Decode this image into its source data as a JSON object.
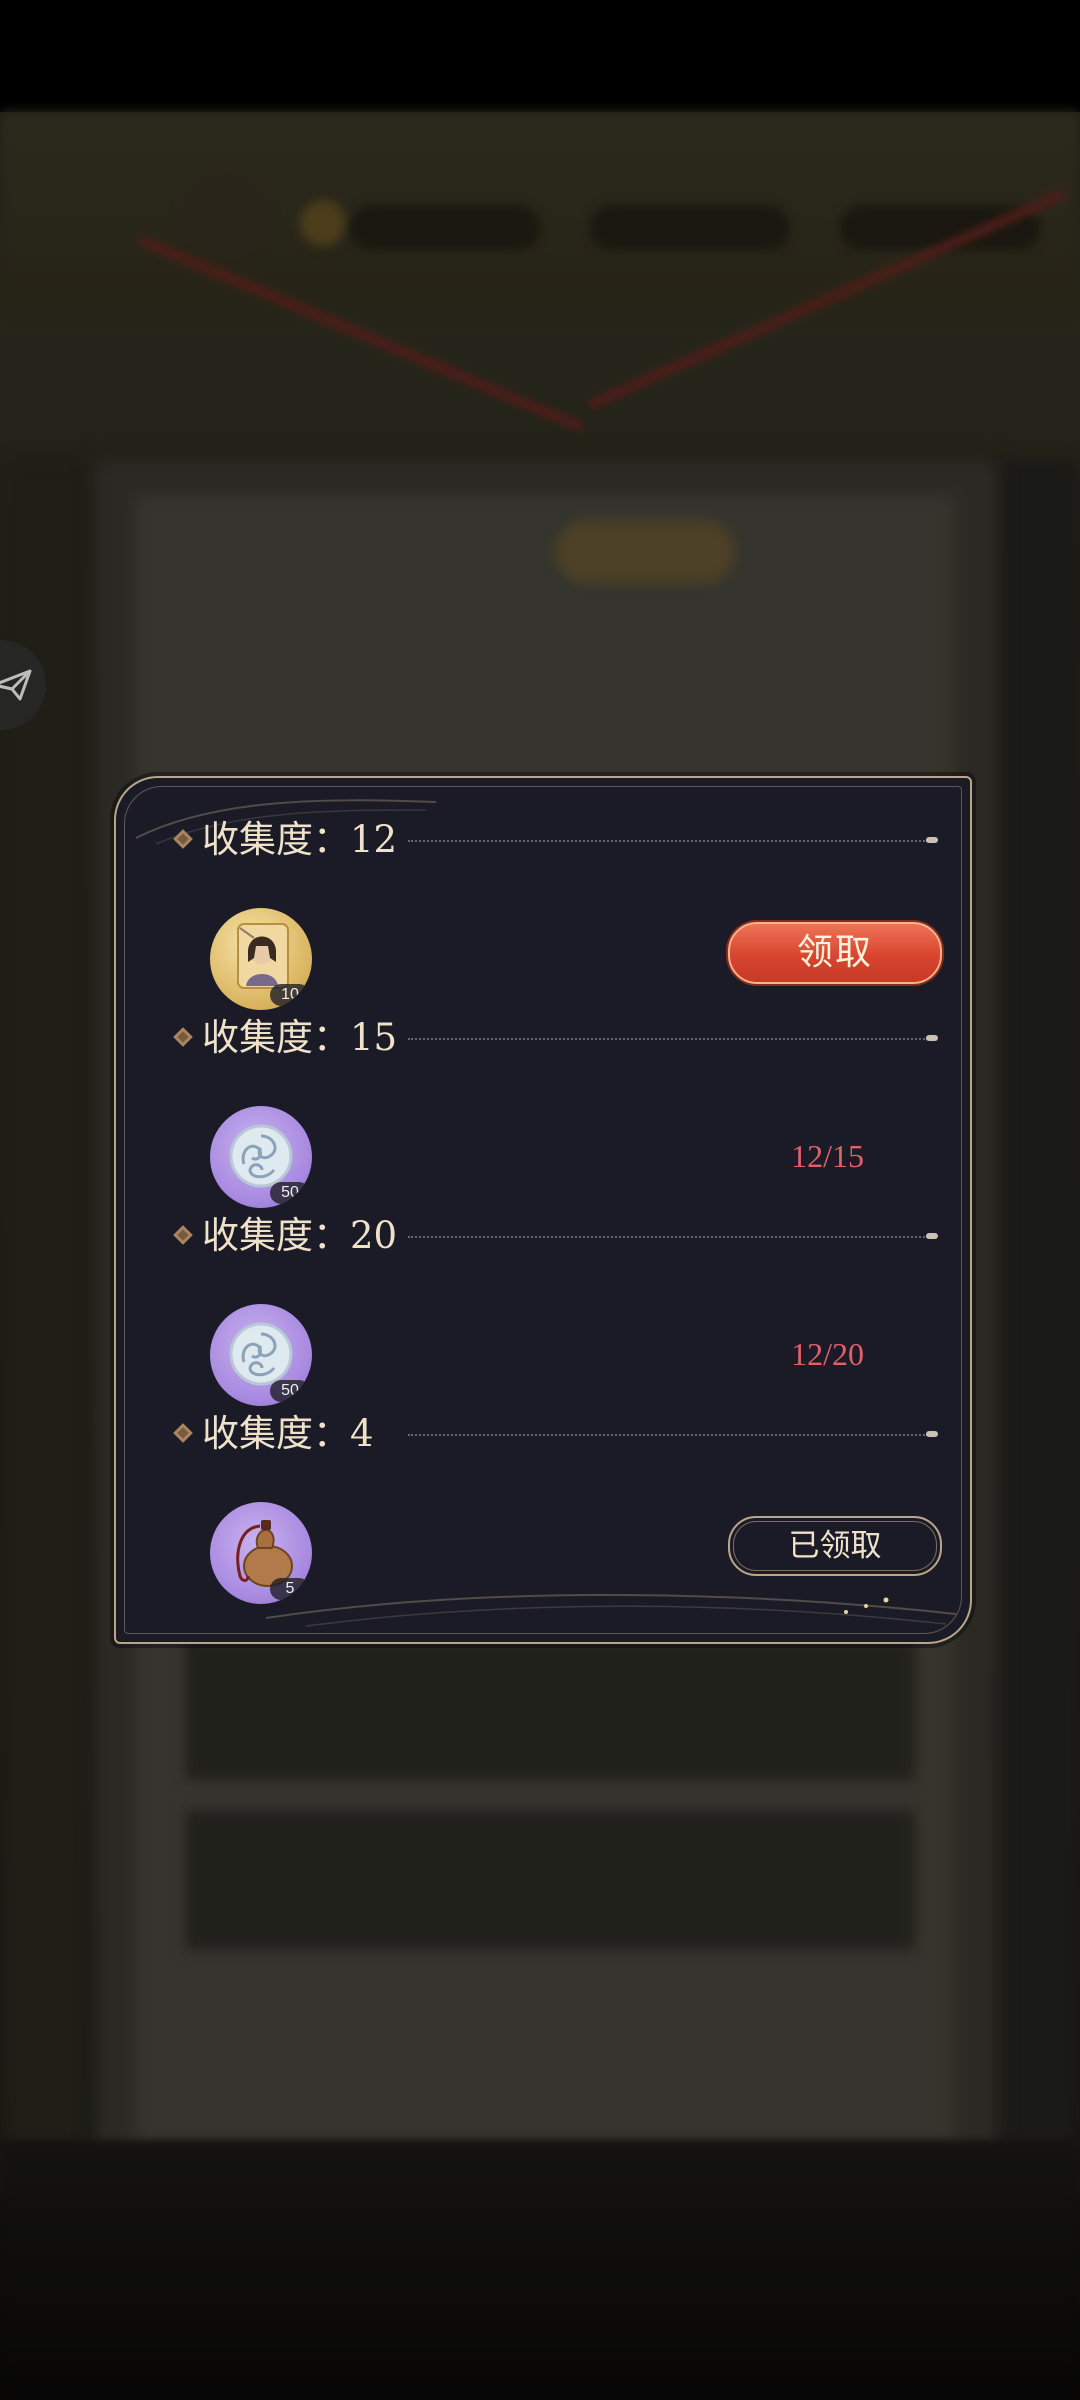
{
  "dialog": {
    "tiers": [
      {
        "title": "收集度：12",
        "reward_count": "10",
        "reward_icon": "character-portrait-icon",
        "action_label": "领取",
        "state": "claimable"
      },
      {
        "title": "收集度：15",
        "reward_count": "50",
        "reward_icon": "jade-swirl-token-icon",
        "progress": "12/15",
        "state": "in-progress"
      },
      {
        "title": "收集度：20",
        "reward_count": "50",
        "reward_icon": "jade-swirl-token-icon",
        "progress": "12/20",
        "state": "in-progress"
      },
      {
        "title": "收集度：4",
        "reward_count": "5",
        "reward_icon": "gourd-flask-icon",
        "action_label": "已领取",
        "state": "claimed"
      }
    ]
  },
  "colors": {
    "dialog_bg": "#1b1b27",
    "border_gold": "#b9a58a",
    "claim_red": "#d8452f",
    "progress_red": "#e0616a",
    "title_cream": "#efe2c8"
  }
}
